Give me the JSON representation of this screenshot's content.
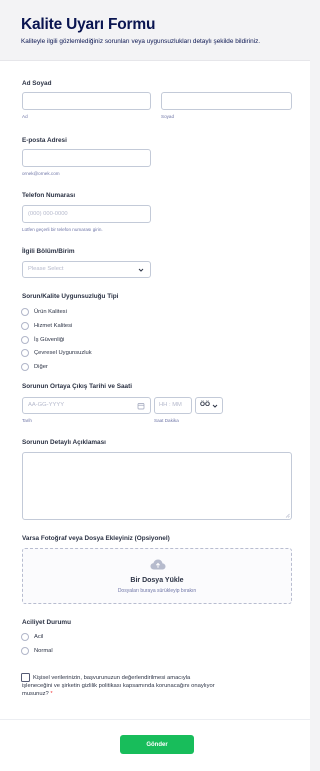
{
  "header": {
    "title": "Kalite Uyarı Formu",
    "subtitle": "Kaliteyle ilgili gözlemlediğiniz sorunları veya uygunsuzlukları detaylı şekilde bildiriniz."
  },
  "name": {
    "label": "Ad Soyad",
    "first_sub": "Ad",
    "last_sub": "Soyad",
    "first_value": "",
    "last_value": ""
  },
  "email": {
    "label": "E-posta Adresi",
    "sub": "ornek@ornek.com",
    "value": ""
  },
  "phone": {
    "label": "Telefon Numarası",
    "placeholder": "(000) 000-0000",
    "sub": "Lütfen geçerli bir telefon numarası girin."
  },
  "department": {
    "label": "İlgili Bölüm/Birim",
    "placeholder": "Please Select"
  },
  "issue_type": {
    "label": "Sorun/Kalite Uygunsuzluğu Tipi",
    "options": [
      "Ürün Kalitesi",
      "Hizmet Kalitesi",
      "İş Güvenliği",
      "Çevresel Uygunsuzluk",
      "Diğer"
    ]
  },
  "datetime": {
    "label": "Sorunun Ortaya Çıkış Tarihi ve Saati",
    "date_placeholder": "AA-GG-YYYY",
    "date_sub": "Tarih",
    "time_placeholder": "HH : MM",
    "time_sub": "Saat Dakika",
    "ampm_value": "ÖÖ"
  },
  "description": {
    "label": "Sorunun Detaylı Açıklaması",
    "value": ""
  },
  "upload": {
    "label": "Varsa Fotoğraf veya Dosya Ekleyiniz (Opsiyonel)",
    "title": "Bir Dosya Yükle",
    "hint": "Dosyaları buraya sürükleyip bırakın"
  },
  "urgency": {
    "label": "Aciliyet Durumu",
    "options": [
      "Acil",
      "Normal"
    ]
  },
  "consent": {
    "line1": "Kişisel verilerinizin, başvurunuzun değerlendirilmesi amacıyla",
    "line2": "işleneceğini ve şirketin gizlilik politikası kapsamında korunacağını onaylıyor",
    "line3": "musunuz?",
    "required_mark": "*"
  },
  "submit": {
    "label": "Gönder"
  },
  "colors": {
    "accent": "#18bd5b",
    "title": "#0a1551",
    "required": "#f23a3c"
  }
}
